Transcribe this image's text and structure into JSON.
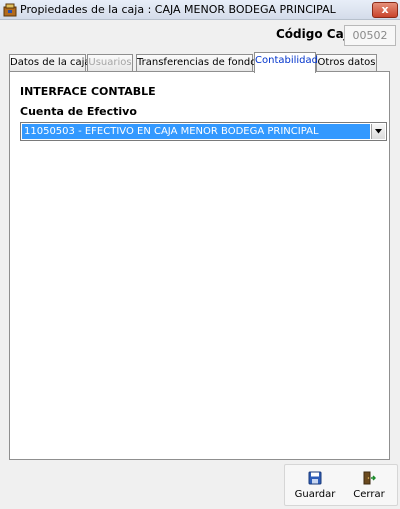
{
  "window": {
    "title": "Propiedades de la caja : CAJA MENOR BODEGA PRINCIPAL",
    "close_label": "x"
  },
  "header": {
    "codigo_label": "Código Caja",
    "codigo_value": "00502"
  },
  "tabs": [
    {
      "label": "Datos de la caja",
      "state": "normal"
    },
    {
      "label": "Usuarios",
      "state": "disabled"
    },
    {
      "label": "Transferencias de fondos",
      "state": "normal"
    },
    {
      "label": "Contabilidad",
      "state": "active"
    },
    {
      "label": "Otros datos",
      "state": "normal"
    }
  ],
  "panel": {
    "section_title": "INTERFACE CONTABLE",
    "cuenta_label": "Cuenta de Efectivo",
    "cuenta_value": "11050503 - EFECTIVO EN CAJA MENOR BODEGA PRINCIPAL"
  },
  "actions": {
    "guardar_label": "Guardar",
    "cerrar_label": "Cerrar"
  },
  "icons": {
    "app": "cash-box-icon",
    "guardar": "save-disk-icon",
    "cerrar": "exit-door-icon",
    "dropdown": "chevron-down-icon"
  },
  "colors": {
    "selection": "#3399ff",
    "active_tab_text": "#0033cc",
    "close_button": "#c9442c"
  }
}
